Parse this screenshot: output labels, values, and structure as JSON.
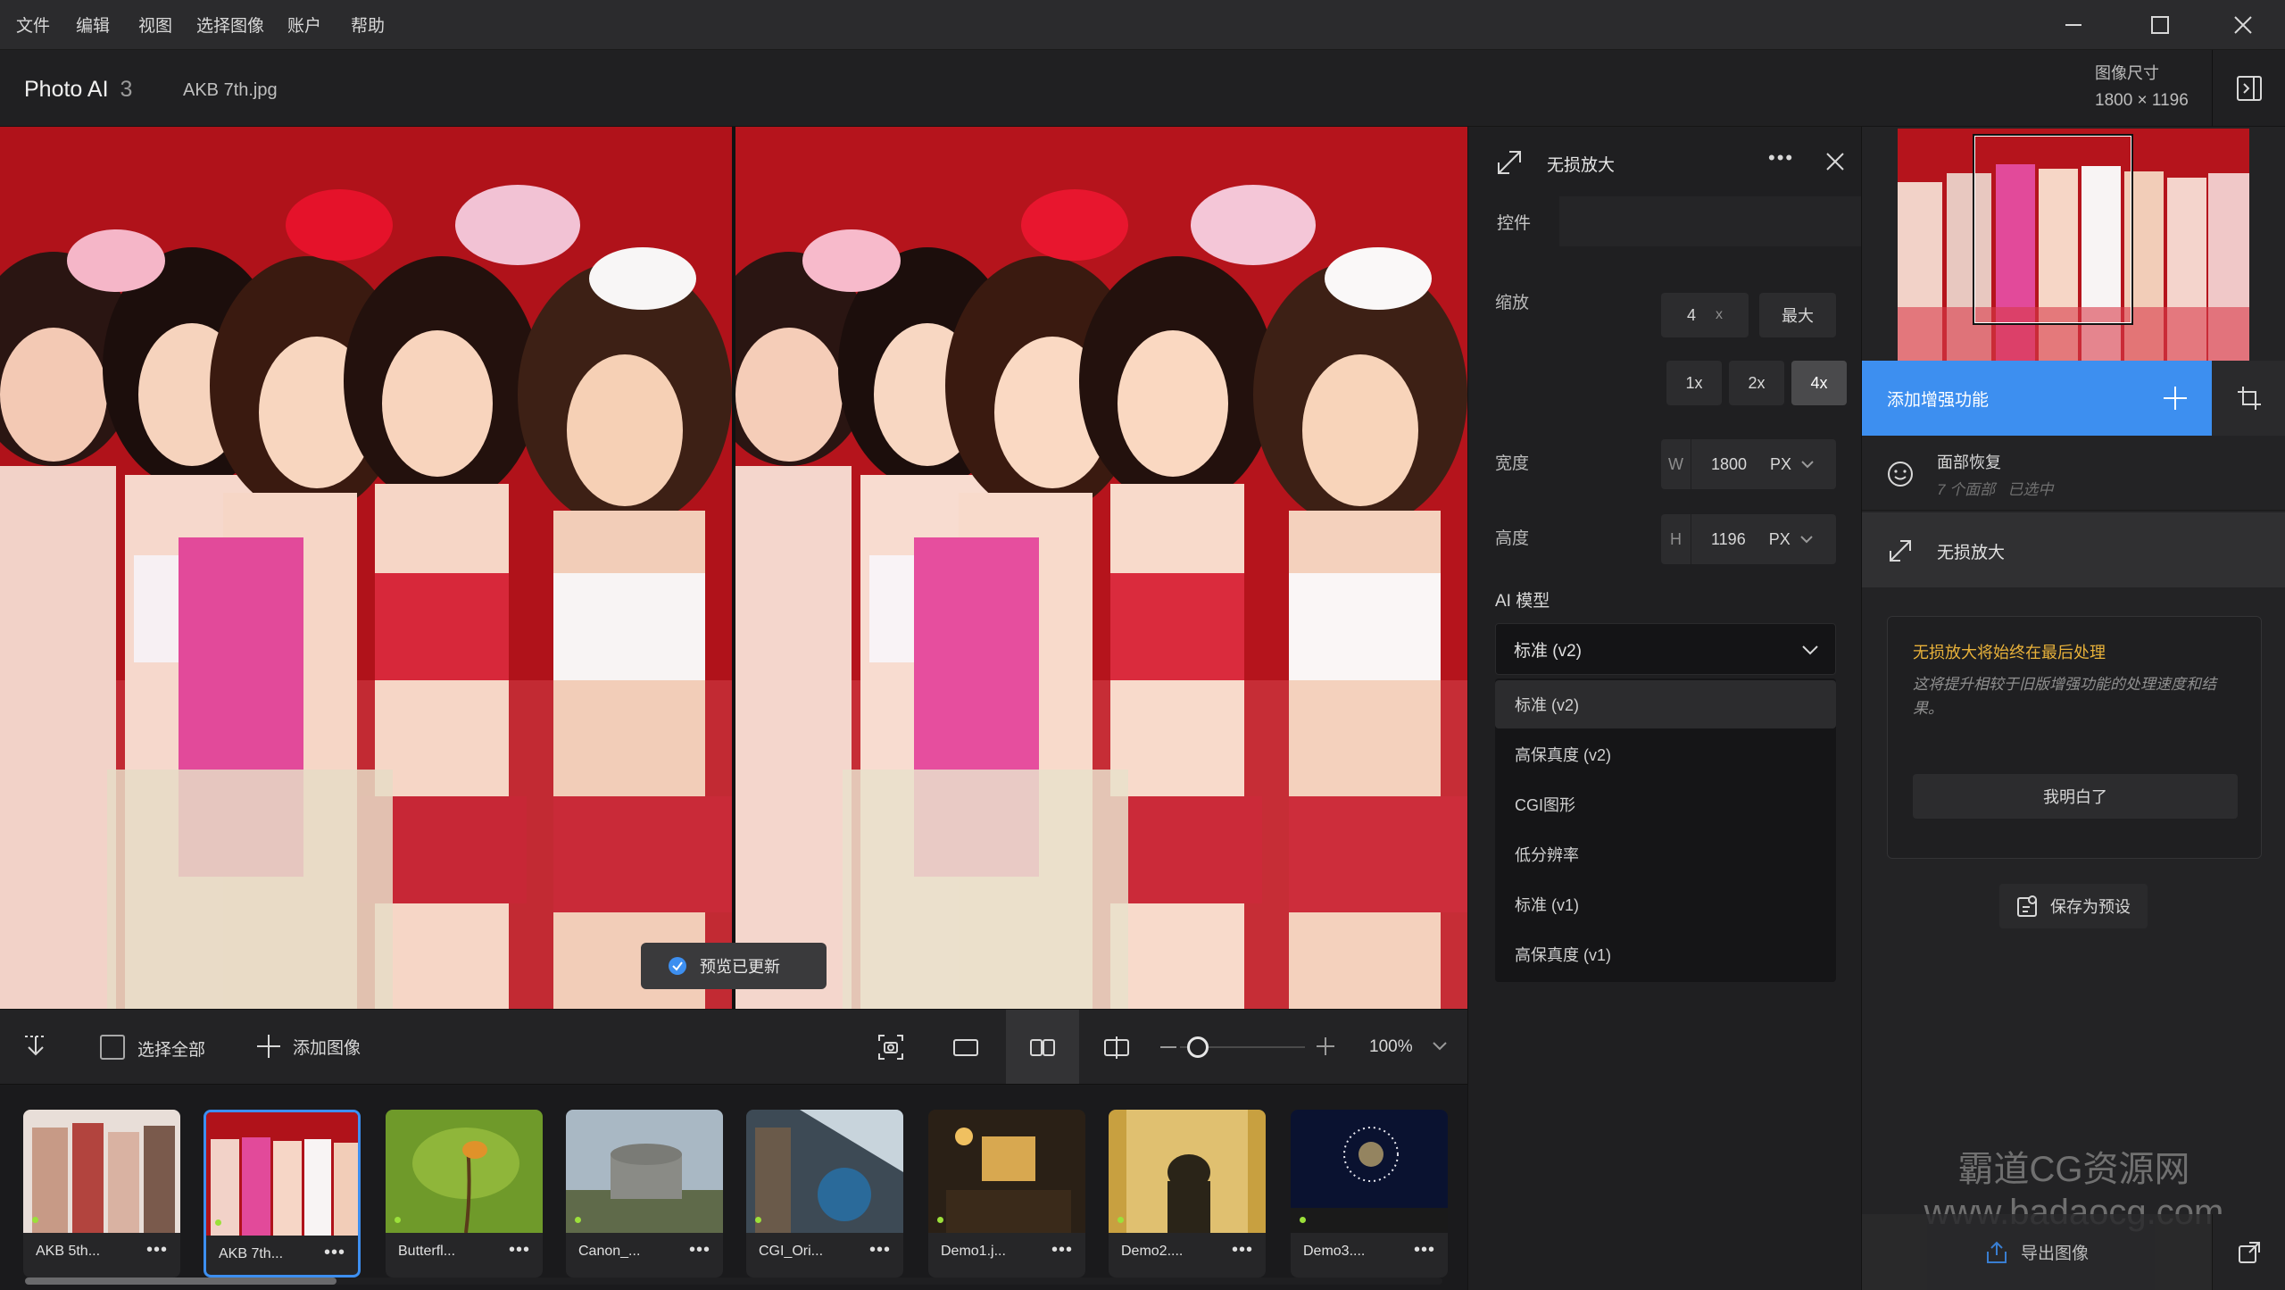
{
  "menu": [
    "文件",
    "编辑",
    "视图",
    "选择图像",
    "账户",
    "帮助"
  ],
  "app": {
    "name": "Photo AI",
    "version": "3",
    "file": "AKB 7th.jpg"
  },
  "image_size": {
    "label": "图像尺寸",
    "value": "1800 × 1196"
  },
  "viewer": {
    "toast": "预览已更新"
  },
  "toolbar": {
    "select_all": "选择全部",
    "add_image": "添加图像",
    "zoom": "100%"
  },
  "filmstrip": [
    {
      "name": "AKB 5th...",
      "selected": false
    },
    {
      "name": "AKB 7th...",
      "selected": true
    },
    {
      "name": "Butterfl...",
      "selected": false
    },
    {
      "name": "Canon_...",
      "selected": false
    },
    {
      "name": "CGI_Ori...",
      "selected": false
    },
    {
      "name": "Demo1.j...",
      "selected": false
    },
    {
      "name": "Demo2....",
      "selected": false
    },
    {
      "name": "Demo3....",
      "selected": false
    }
  ],
  "filmstrip_scroll_fraction": 0.22,
  "settings": {
    "title": "无损放大",
    "tab": "控件",
    "scale_label": "缩放",
    "scale_value": "4",
    "scale_unit": "x",
    "max_label": "最大",
    "presets": [
      "1x",
      "2x",
      "4x"
    ],
    "active_preset": "4x",
    "width_label": "宽度",
    "width_prefix": "W",
    "width_value": "1800",
    "height_label": "高度",
    "height_prefix": "H",
    "height_value": "1196",
    "unit": "PX",
    "ai_model_label": "AI 模型",
    "ai_model_selected": "标准 (v2)",
    "ai_model_options": [
      "标准 (v2)",
      "高保真度 (v2)",
      "CGI图形",
      "低分辨率",
      "标准 (v1)",
      "高保真度 (v1)"
    ]
  },
  "right": {
    "add_enhance": "添加增强功能",
    "face_title": "面部恢复",
    "face_sub": "7 个面部   已选中",
    "upscale": "无损放大",
    "notice_title": "无损放大将始终在最后处理",
    "notice_body": "这将提升相较于旧版增强功能的处理速度和结果。",
    "ok": "我明白了",
    "save_preset": "保存为预设",
    "export": "导出图像"
  },
  "watermark": {
    "line1": "霸道CG资源网",
    "line2": "www.badaocg.com"
  },
  "colors": {
    "accent": "#3d8ff0",
    "notice": "#e9b23a",
    "bg": "#1d1d1f"
  }
}
